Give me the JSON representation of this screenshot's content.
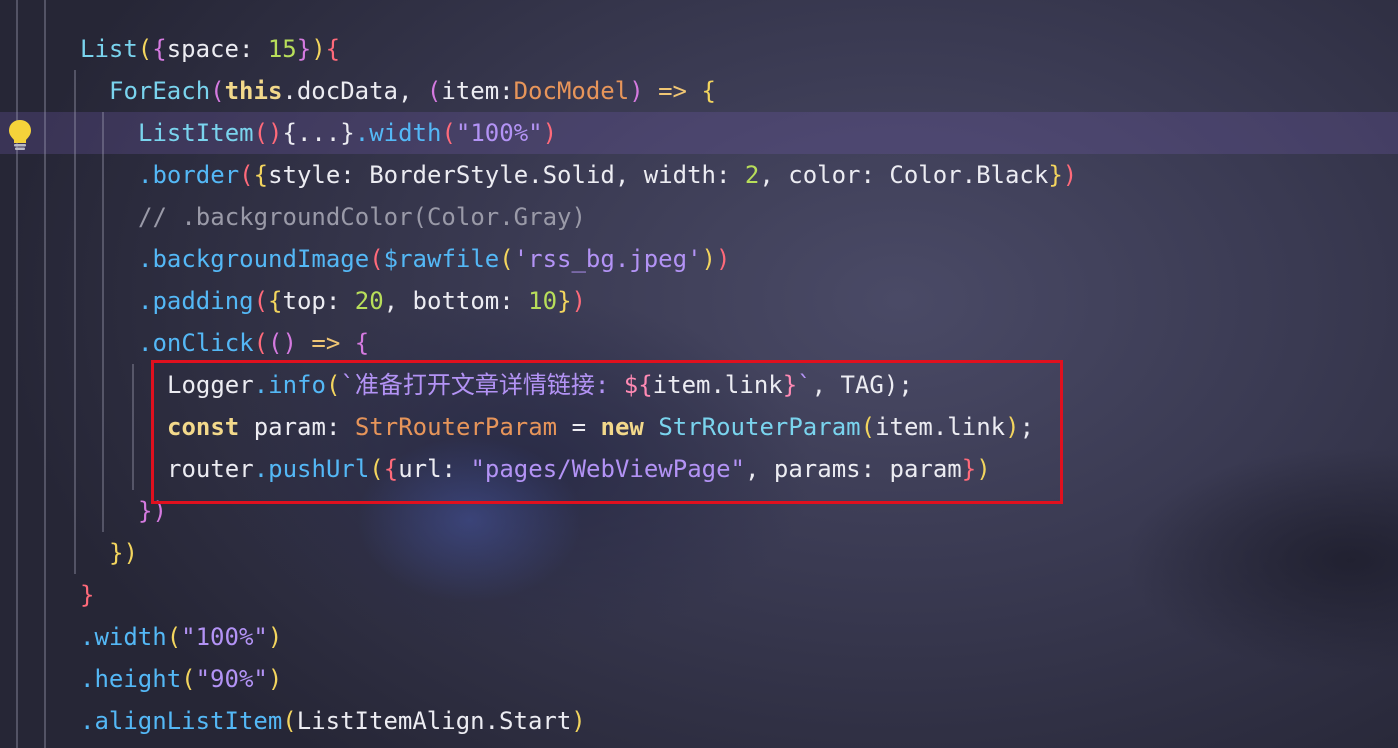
{
  "editor": {
    "lines": [
      {
        "indent": 1,
        "tokens": [
          {
            "t": "List",
            "c": "t-type"
          },
          {
            "t": "(",
            "c": "t-paren1"
          },
          {
            "t": "{",
            "c": "t-paren2"
          },
          {
            "t": "space: ",
            "c": "t-plain"
          },
          {
            "t": "15",
            "c": "t-num"
          },
          {
            "t": "}",
            "c": "t-paren2"
          },
          {
            "t": ")",
            "c": "t-paren1"
          },
          {
            "t": "{",
            "c": "t-paren4"
          }
        ]
      },
      {
        "indent": 2,
        "tokens": [
          {
            "t": "ForEach",
            "c": "t-type"
          },
          {
            "t": "(",
            "c": "t-paren2"
          },
          {
            "t": "this",
            "c": "t-kw"
          },
          {
            "t": ".docData, ",
            "c": "t-plain"
          },
          {
            "t": "(",
            "c": "t-paren2"
          },
          {
            "t": "item:",
            "c": "t-plain"
          },
          {
            "t": "DocModel",
            "c": "t-cls"
          },
          {
            "t": ")",
            "c": "t-paren2"
          },
          {
            "t": " => ",
            "c": "t-op"
          },
          {
            "t": "{",
            "c": "t-paren1"
          }
        ]
      },
      {
        "indent": 3,
        "tokens": [
          {
            "t": "ListItem",
            "c": "t-type"
          },
          {
            "t": "()",
            "c": "t-paren4"
          },
          {
            "t": "{...}",
            "c": "t-plain"
          },
          {
            "t": ".width",
            "c": "t-fn"
          },
          {
            "t": "(",
            "c": "t-paren4"
          },
          {
            "t": "\"100%\"",
            "c": "t-str"
          },
          {
            "t": ")",
            "c": "t-paren4"
          }
        ]
      },
      {
        "indent": 3,
        "tokens": [
          {
            "t": ".border",
            "c": "t-fn"
          },
          {
            "t": "(",
            "c": "t-paren4"
          },
          {
            "t": "{",
            "c": "t-paren1"
          },
          {
            "t": "style: BorderStyle.Solid, width: ",
            "c": "t-plain"
          },
          {
            "t": "2",
            "c": "t-num"
          },
          {
            "t": ", color: Color.Black",
            "c": "t-plain"
          },
          {
            "t": "}",
            "c": "t-paren1"
          },
          {
            "t": ")",
            "c": "t-paren4"
          }
        ]
      },
      {
        "indent": 3,
        "tokens": [
          {
            "t": "// .backgroundColor(Color.Gray)",
            "c": "t-comment"
          }
        ]
      },
      {
        "indent": 3,
        "tokens": [
          {
            "t": ".backgroundImage",
            "c": "t-fn"
          },
          {
            "t": "(",
            "c": "t-paren4"
          },
          {
            "t": "$rawfile",
            "c": "t-fn"
          },
          {
            "t": "(",
            "c": "t-paren1"
          },
          {
            "t": "'rss_bg.jpeg'",
            "c": "t-str"
          },
          {
            "t": ")",
            "c": "t-paren1"
          },
          {
            "t": ")",
            "c": "t-paren4"
          }
        ]
      },
      {
        "indent": 3,
        "tokens": [
          {
            "t": ".padding",
            "c": "t-fn"
          },
          {
            "t": "(",
            "c": "t-paren4"
          },
          {
            "t": "{",
            "c": "t-paren1"
          },
          {
            "t": "top: ",
            "c": "t-plain"
          },
          {
            "t": "20",
            "c": "t-num"
          },
          {
            "t": ", bottom: ",
            "c": "t-plain"
          },
          {
            "t": "10",
            "c": "t-num"
          },
          {
            "t": "}",
            "c": "t-paren1"
          },
          {
            "t": ")",
            "c": "t-paren4"
          }
        ]
      },
      {
        "indent": 3,
        "tokens": [
          {
            "t": ".onClick",
            "c": "t-fn"
          },
          {
            "t": "(",
            "c": "t-paren4"
          },
          {
            "t": "()",
            "c": "t-paren2"
          },
          {
            "t": " => ",
            "c": "t-op"
          },
          {
            "t": "{",
            "c": "t-paren2"
          }
        ]
      },
      {
        "indent": 4,
        "tokens": [
          {
            "t": "Logger",
            "c": "t-plain"
          },
          {
            "t": ".info",
            "c": "t-fn"
          },
          {
            "t": "(",
            "c": "t-paren1"
          },
          {
            "t": "`准备打开文章详情链接: ",
            "c": "t-str"
          },
          {
            "t": "${",
            "c": "t-dollar"
          },
          {
            "t": "item.link",
            "c": "t-plain"
          },
          {
            "t": "}",
            "c": "t-dollar"
          },
          {
            "t": "`",
            "c": "t-str"
          },
          {
            "t": ", TAG);",
            "c": "t-plain"
          }
        ]
      },
      {
        "indent": 4,
        "tokens": [
          {
            "t": "const",
            "c": "t-kw"
          },
          {
            "t": " param: ",
            "c": "t-plain"
          },
          {
            "t": "StrRouterParam",
            "c": "t-cls"
          },
          {
            "t": " = ",
            "c": "t-plain"
          },
          {
            "t": "new",
            "c": "t-kw"
          },
          {
            "t": " ",
            "c": "t-plain"
          },
          {
            "t": "StrRouterParam",
            "c": "t-type"
          },
          {
            "t": "(",
            "c": "t-paren1"
          },
          {
            "t": "item.link",
            "c": "t-plain"
          },
          {
            "t": ")",
            "c": "t-paren1"
          },
          {
            "t": ";",
            "c": "t-plain"
          }
        ]
      },
      {
        "indent": 4,
        "tokens": [
          {
            "t": "router",
            "c": "t-plain"
          },
          {
            "t": ".pushUrl",
            "c": "t-fn"
          },
          {
            "t": "(",
            "c": "t-paren1"
          },
          {
            "t": "{",
            "c": "t-paren4"
          },
          {
            "t": "url: ",
            "c": "t-plain"
          },
          {
            "t": "\"pages/WebViewPage\"",
            "c": "t-str"
          },
          {
            "t": ", params: param",
            "c": "t-plain"
          },
          {
            "t": "}",
            "c": "t-paren4"
          },
          {
            "t": ")",
            "c": "t-paren1"
          }
        ]
      },
      {
        "indent": 3,
        "tokens": [
          {
            "t": "})",
            "c": "t-paren2"
          }
        ]
      },
      {
        "indent": 2,
        "tokens": [
          {
            "t": "})",
            "c": "t-paren1"
          }
        ]
      },
      {
        "indent": 1,
        "tokens": [
          {
            "t": "}",
            "c": "t-paren4"
          }
        ]
      },
      {
        "indent": 1,
        "tokens": [
          {
            "t": ".width",
            "c": "t-fn"
          },
          {
            "t": "(",
            "c": "t-paren1"
          },
          {
            "t": "\"100%\"",
            "c": "t-str"
          },
          {
            "t": ")",
            "c": "t-paren1"
          }
        ]
      },
      {
        "indent": 1,
        "tokens": [
          {
            "t": ".height",
            "c": "t-fn"
          },
          {
            "t": "(",
            "c": "t-paren1"
          },
          {
            "t": "\"90%\"",
            "c": "t-str"
          },
          {
            "t": ")",
            "c": "t-paren1"
          }
        ]
      },
      {
        "indent": 1,
        "tokens": [
          {
            "t": ".alignListItem",
            "c": "t-fn"
          },
          {
            "t": "(",
            "c": "t-paren1"
          },
          {
            "t": "ListItemAlign.Start",
            "c": "t-plain"
          },
          {
            "t": ")",
            "c": "t-paren1"
          }
        ]
      }
    ]
  },
  "gutter": {
    "lightbulb_icon": "lightbulb-icon",
    "highlighted_line": 2
  },
  "colors": {
    "highlight_box": "#e0101e",
    "current_line": "#6e5aaa"
  }
}
